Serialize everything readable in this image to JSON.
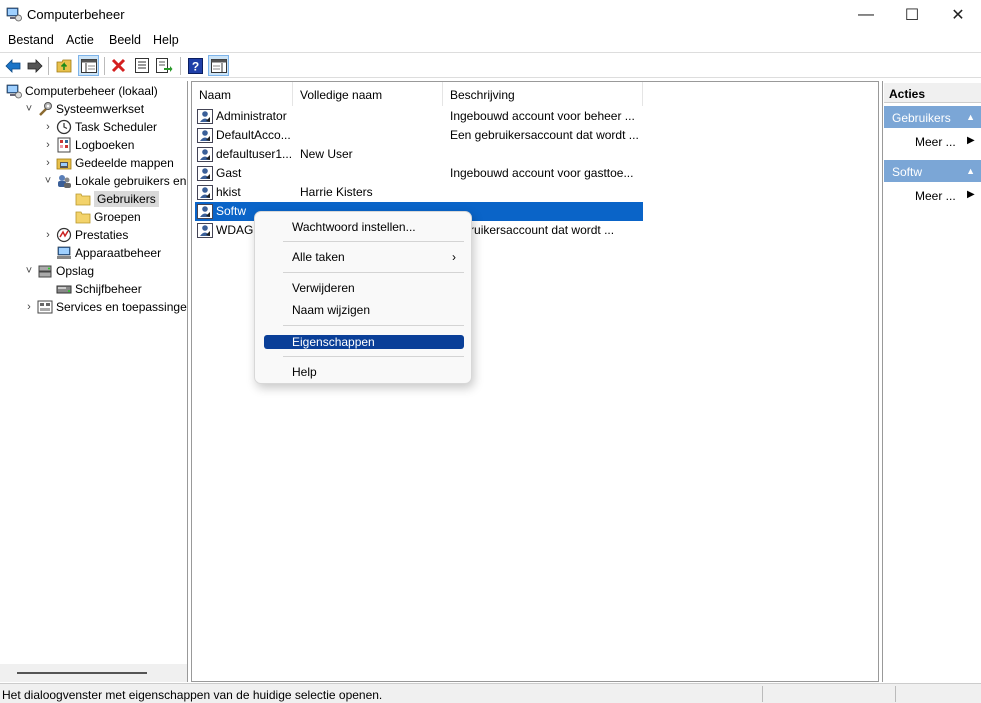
{
  "window": {
    "title": "Computerbeheer",
    "minimize_glyph": "—",
    "maximize_glyph": "☐",
    "close_glyph": "✕"
  },
  "menu": [
    "Bestand",
    "Actie",
    "Beeld",
    "Help"
  ],
  "toolbar_icons": [
    "back-arrow-icon",
    "forward-arrow-icon",
    "up-folder-icon",
    "show-hide-tree-icon",
    "delete-icon",
    "properties-icon",
    "export-list-icon",
    "help-icon",
    "show-hide-action-pane-icon"
  ],
  "tree": [
    {
      "label": "Computerbeheer (lokaal)",
      "indent": 0,
      "expander": "",
      "icon": "computer-management-icon"
    },
    {
      "label": "Systeemwerkset",
      "indent": 1,
      "expander": "˅",
      "icon": "system-tools-icon"
    },
    {
      "label": "Task Scheduler",
      "indent": 2,
      "expander": "›",
      "icon": "clock-icon"
    },
    {
      "label": "Logboeken",
      "indent": 2,
      "expander": "›",
      "icon": "event-log-icon"
    },
    {
      "label": "Gedeelde mappen",
      "indent": 2,
      "expander": "›",
      "icon": "shared-folder-icon"
    },
    {
      "label": "Lokale gebruikers en groepen",
      "indent": 2,
      "expander": "˅",
      "icon": "users-groups-icon"
    },
    {
      "label": "Gebruikers",
      "indent": 3,
      "expander": "",
      "icon": "folder-icon",
      "selected": true
    },
    {
      "label": "Groepen",
      "indent": 3,
      "expander": "",
      "icon": "folder-icon"
    },
    {
      "label": "Prestaties",
      "indent": 2,
      "expander": "›",
      "icon": "performance-icon"
    },
    {
      "label": "Apparaatbeheer",
      "indent": 2,
      "expander": "",
      "icon": "device-manager-icon"
    },
    {
      "label": "Opslag",
      "indent": 1,
      "expander": "˅",
      "icon": "storage-icon"
    },
    {
      "label": "Schijfbeheer",
      "indent": 2,
      "expander": "",
      "icon": "disk-icon"
    },
    {
      "label": "Services en toepassingen",
      "indent": 1,
      "expander": "›",
      "icon": "services-icon"
    }
  ],
  "list": {
    "columns": [
      "Naam",
      "Volledige naam",
      "Beschrijving"
    ],
    "rows": [
      {
        "name": "Administrator",
        "fullname": "",
        "desc": "Ingebouwd account voor beheer ..."
      },
      {
        "name": "DefaultAcco...",
        "fullname": "",
        "desc": "Een gebruikersaccount dat wordt ..."
      },
      {
        "name": "defaultuser1...",
        "fullname": "New User",
        "desc": ""
      },
      {
        "name": "Gast",
        "fullname": "",
        "desc": "Ingebouwd account voor gasttoe..."
      },
      {
        "name": "hkist",
        "fullname": "Harrie Kisters",
        "desc": ""
      },
      {
        "name": "Softw",
        "fullname": "",
        "desc": "",
        "selected": true
      },
      {
        "name": "WDAGU",
        "fullname": "",
        "desc": "gebruikersaccount dat wordt ..."
      }
    ]
  },
  "context_menu": {
    "items": [
      "Wachtwoord instellen...",
      "Alle taken",
      "Verwijderen",
      "Naam wijzigen",
      "Eigenschappen",
      "Help"
    ],
    "submenu_arrow": "›",
    "highlighted": "Eigenschappen"
  },
  "actions": {
    "title": "Acties",
    "sections": [
      {
        "label": "Gebruikers",
        "more": "Meer ..."
      },
      {
        "label": "Softw",
        "more": "Meer ..."
      }
    ],
    "collapse_glyph": "▲",
    "more_glyph": "▶"
  },
  "status": {
    "text": "Het dialoogvenster met eigenschappen van de huidige selectie openen."
  },
  "colors": {
    "selection": "#0a64c8",
    "menu_highlight": "#0a3f98",
    "action_header": "#7ba6d6",
    "tree_selected": "#d9d9d9"
  }
}
